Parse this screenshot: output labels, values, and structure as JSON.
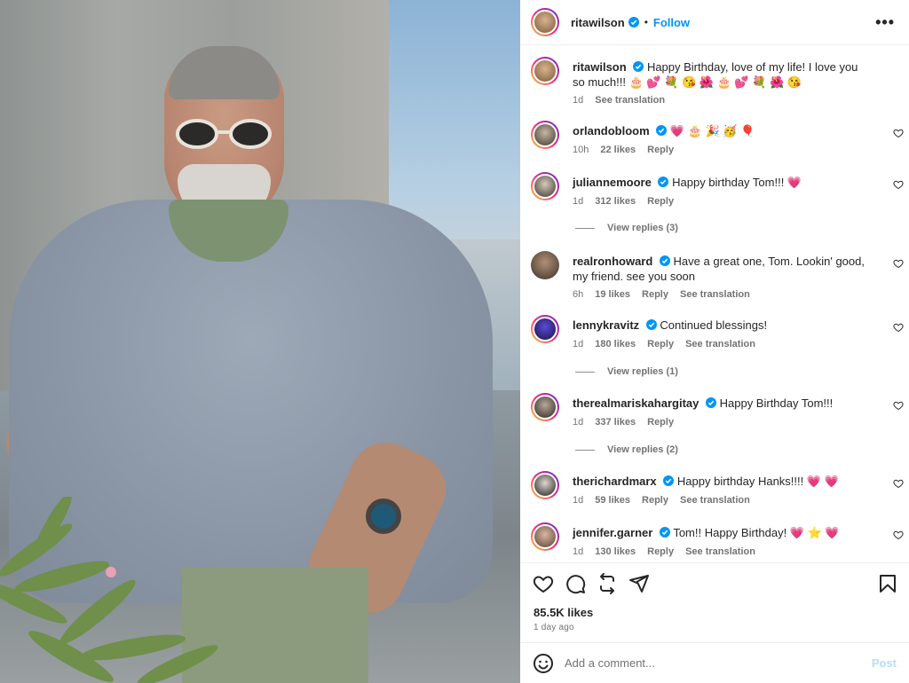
{
  "header": {
    "username": "ritawilson",
    "separator": "•",
    "follow_label": "Follow",
    "more_label": "•••"
  },
  "caption": {
    "username": "ritawilson",
    "text": "Happy Birthday, love of my life! I love you so much!!! 🎂 💕 💐 😘 🌺 🎂 💕 💐 🌺 😘",
    "time": "1d",
    "see_translation": "See translation"
  },
  "comments": [
    {
      "username": "orlandobloom",
      "text": "💗 🎂 🎉 🥳 🎈",
      "time": "10h",
      "likes": "22 likes",
      "reply": "Reply",
      "see_translation": "",
      "view_replies": ""
    },
    {
      "username": "juliannemoore",
      "text": "Happy birthday Tom!!! 💗",
      "time": "1d",
      "likes": "312 likes",
      "reply": "Reply",
      "see_translation": "",
      "view_replies": "View replies (3)"
    },
    {
      "username": "realronhoward",
      "text": "Have a great one, Tom. Lookin' good, my friend. see you soon",
      "time": "6h",
      "likes": "19 likes",
      "reply": "Reply",
      "see_translation": "See translation",
      "view_replies": ""
    },
    {
      "username": "lennykravitz",
      "text": "Continued blessings!",
      "time": "1d",
      "likes": "180 likes",
      "reply": "Reply",
      "see_translation": "See translation",
      "view_replies": "View replies (1)"
    },
    {
      "username": "therealmariskahargitay",
      "text": "Happy Birthday Tom!!!",
      "time": "1d",
      "likes": "337 likes",
      "reply": "Reply",
      "see_translation": "",
      "view_replies": "View replies (2)"
    },
    {
      "username": "therichardmarx",
      "text": "Happy birthday Hanks!!!! 💗 💗",
      "time": "1d",
      "likes": "59 likes",
      "reply": "Reply",
      "see_translation": "See translation",
      "view_replies": ""
    },
    {
      "username": "jennifer.garner",
      "text": "Tom!! Happy Birthday! 💗 ⭐ 💗",
      "time": "1d",
      "likes": "130 likes",
      "reply": "Reply",
      "see_translation": "See translation",
      "view_replies": ""
    }
  ],
  "post": {
    "likes": "85.5K likes",
    "date": "1 day ago"
  },
  "add_comment": {
    "placeholder": "Add a comment...",
    "post_label": "Post"
  },
  "icons": {
    "like": "heart-icon",
    "comment": "comment-icon",
    "repost": "repost-icon",
    "share": "share-icon",
    "save": "bookmark-icon",
    "emoji": "emoji-icon",
    "verified": "verified-badge-icon"
  },
  "colors": {
    "accent": "#0095f6",
    "verified": "#0095f6",
    "text": "#262626",
    "muted": "#737373",
    "post_disabled": "#b2dffc"
  }
}
